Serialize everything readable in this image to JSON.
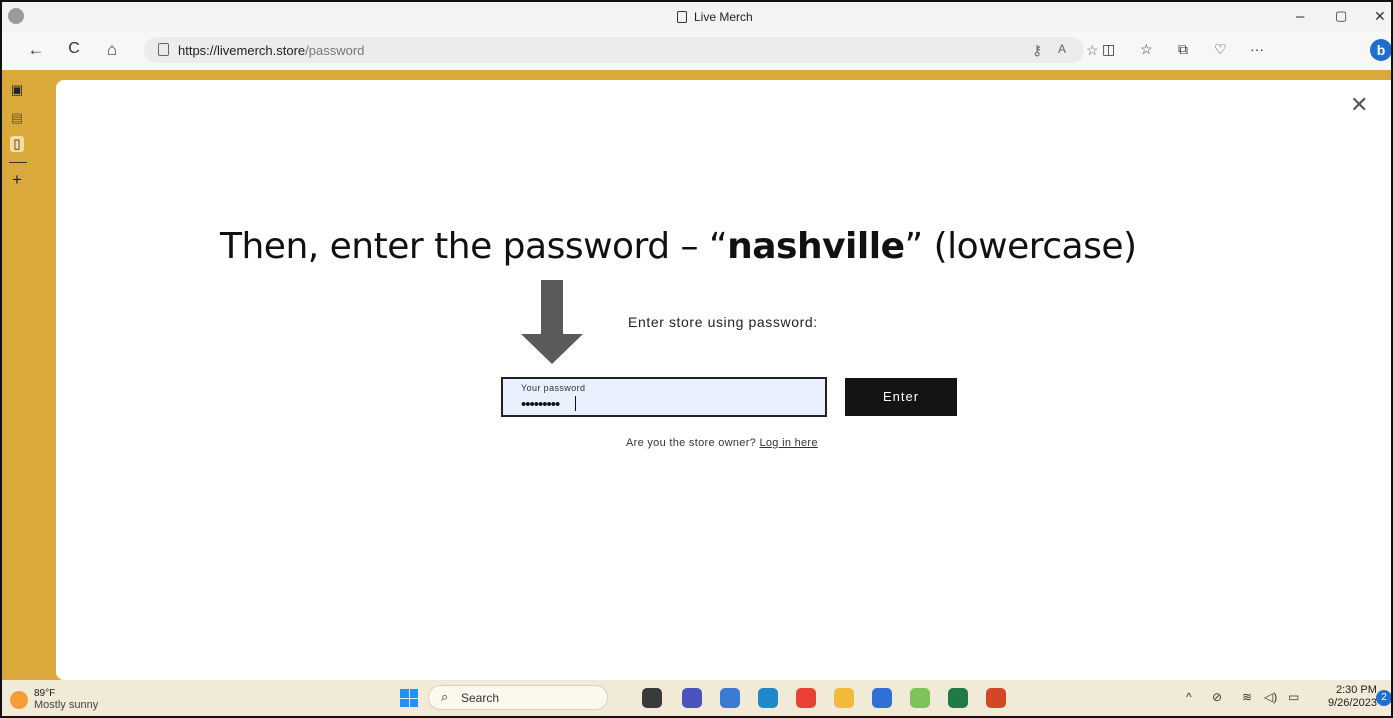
{
  "window": {
    "tab_title": "Live Merch",
    "controls": {
      "minimize": "–",
      "maximize": "▢",
      "close": "✕"
    }
  },
  "navbar": {
    "back": "←",
    "refresh": "C",
    "home": "⌂",
    "url_host": "https://livemerch.store",
    "url_path": "/password",
    "more": "···",
    "bing": "b"
  },
  "sidebar": {
    "add": "+"
  },
  "page": {
    "close": "✕",
    "headline_pre": "Then, enter the password –  “",
    "headline_bold": "nashville",
    "headline_post": "” (lowercase)",
    "prompt": "Enter store using password:",
    "password_label": "Your password",
    "password_value": "•••••••••",
    "enter_button": "Enter",
    "owner_text": "Are you the store owner? ",
    "owner_link": "Log in here"
  },
  "taskbar": {
    "weather_temp": "89°F",
    "weather_desc": "Mostly sunny",
    "search_label": "Search",
    "time": "2:30 PM",
    "date": "9/26/2023",
    "notification_count": "2",
    "apps": [
      {
        "name": "task-view-icon",
        "color": "#3a3a3a"
      },
      {
        "name": "meet-icon",
        "color": "#4b53bc"
      },
      {
        "name": "widgets-icon",
        "color": "#3b7bd4"
      },
      {
        "name": "edge-icon",
        "color": "#1e88c9"
      },
      {
        "name": "chrome-icon",
        "color": "#e94235"
      },
      {
        "name": "file-explorer-icon",
        "color": "#f3b93b"
      },
      {
        "name": "store-icon",
        "color": "#2f6fd6"
      },
      {
        "name": "globe-icon",
        "color": "#7cc35a"
      },
      {
        "name": "excel-icon",
        "color": "#1f7a45"
      },
      {
        "name": "powerpoint-icon",
        "color": "#d24726"
      }
    ]
  }
}
